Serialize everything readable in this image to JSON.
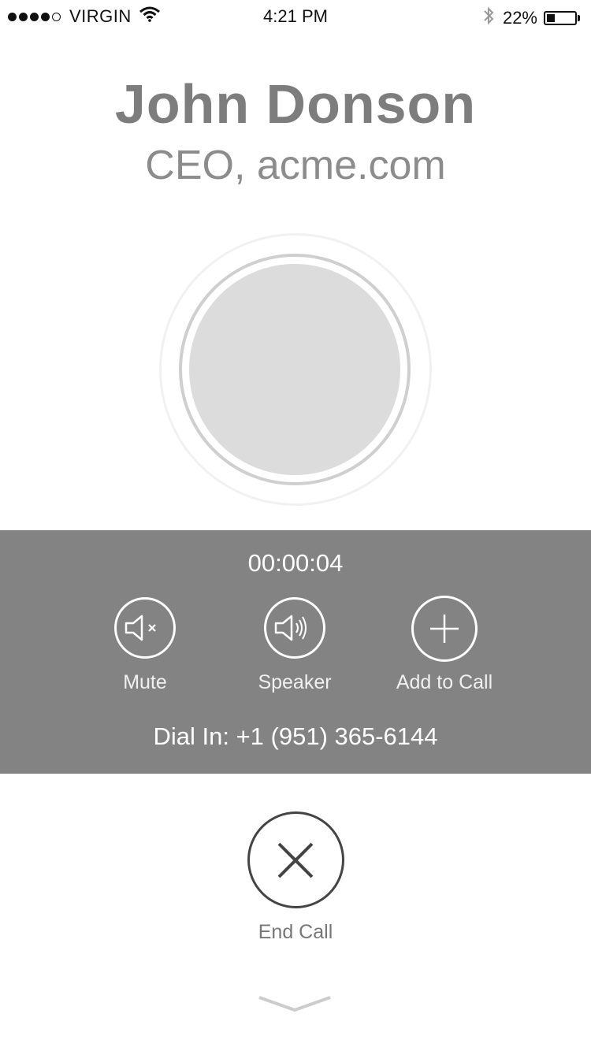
{
  "status_bar": {
    "carrier": "VIRGIN",
    "time": "4:21 PM",
    "battery": "22%",
    "battery_level": 0.22,
    "signal_bars_filled": 4,
    "signal_bars_total": 5,
    "icons": [
      "wifi-icon",
      "bluetooth-icon",
      "battery-icon"
    ]
  },
  "contact": {
    "name": "John Donson",
    "title": "CEO, acme.com"
  },
  "call": {
    "timer": "00:00:04",
    "controls": [
      {
        "label": "Mute",
        "icon": "mute-icon"
      },
      {
        "label": "Speaker",
        "icon": "speaker-icon"
      },
      {
        "label": "Add to Call",
        "icon": "plus-icon"
      }
    ],
    "dial_in": "Dial In: +1 (951) 365-6144",
    "end_call": {
      "label": "End Call",
      "icon": "close-icon"
    }
  },
  "colors": {
    "panel_background": "#838383",
    "avatar_fill": "#dcdcdc",
    "end_call_stroke": "#444444"
  }
}
